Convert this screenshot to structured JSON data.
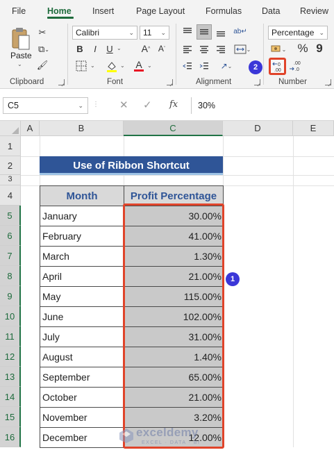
{
  "ribbon": {
    "tabs": [
      "File",
      "Home",
      "Insert",
      "Page Layout",
      "Formulas",
      "Data",
      "Review"
    ],
    "active_tab": "Home",
    "clipboard": {
      "paste_label": "Paste",
      "group_label": "Clipboard"
    },
    "font": {
      "font_name": "Calibri",
      "font_size": "11",
      "bold": "B",
      "italic": "I",
      "underline": "U",
      "group_label": "Font"
    },
    "alignment": {
      "group_label": "Alignment"
    },
    "number": {
      "format": "Percentage",
      "percent": "%",
      "comma": "9",
      "group_label": "Number"
    },
    "callout_badge": "2"
  },
  "formula_bar": {
    "name_box": "C5",
    "fx": "fx",
    "value": "30%"
  },
  "grid": {
    "columns": [
      "A",
      "B",
      "C",
      "D",
      "E"
    ],
    "selected_column": "C",
    "rows": [
      "1",
      "2",
      "3",
      "4",
      "5",
      "6",
      "7",
      "8",
      "9",
      "10",
      "11",
      "12",
      "13",
      "14",
      "15",
      "16"
    ],
    "title": "Use of Ribbon Shortcut",
    "table": {
      "headers": [
        "Month",
        "Profit Percentage"
      ],
      "rows": [
        [
          "January",
          "30.00%"
        ],
        [
          "February",
          "41.00%"
        ],
        [
          "March",
          "1.30%"
        ],
        [
          "April",
          "21.00%"
        ],
        [
          "May",
          "115.00%"
        ],
        [
          "June",
          "102.00%"
        ],
        [
          "July",
          "31.00%"
        ],
        [
          "August",
          "1.40%"
        ],
        [
          "September",
          "65.00%"
        ],
        [
          "October",
          "21.00%"
        ],
        [
          "November",
          "3.20%"
        ],
        [
          "December",
          "12.00%"
        ]
      ]
    },
    "callout_badge": "1"
  },
  "watermark": {
    "main": "exceldemy",
    "sub": "EXCEL · DATA · BI"
  },
  "colors": {
    "accent_green": "#217346",
    "title_fill": "#2f5597",
    "highlight_red": "#e0442a",
    "badge_blue": "#3b37d8"
  }
}
